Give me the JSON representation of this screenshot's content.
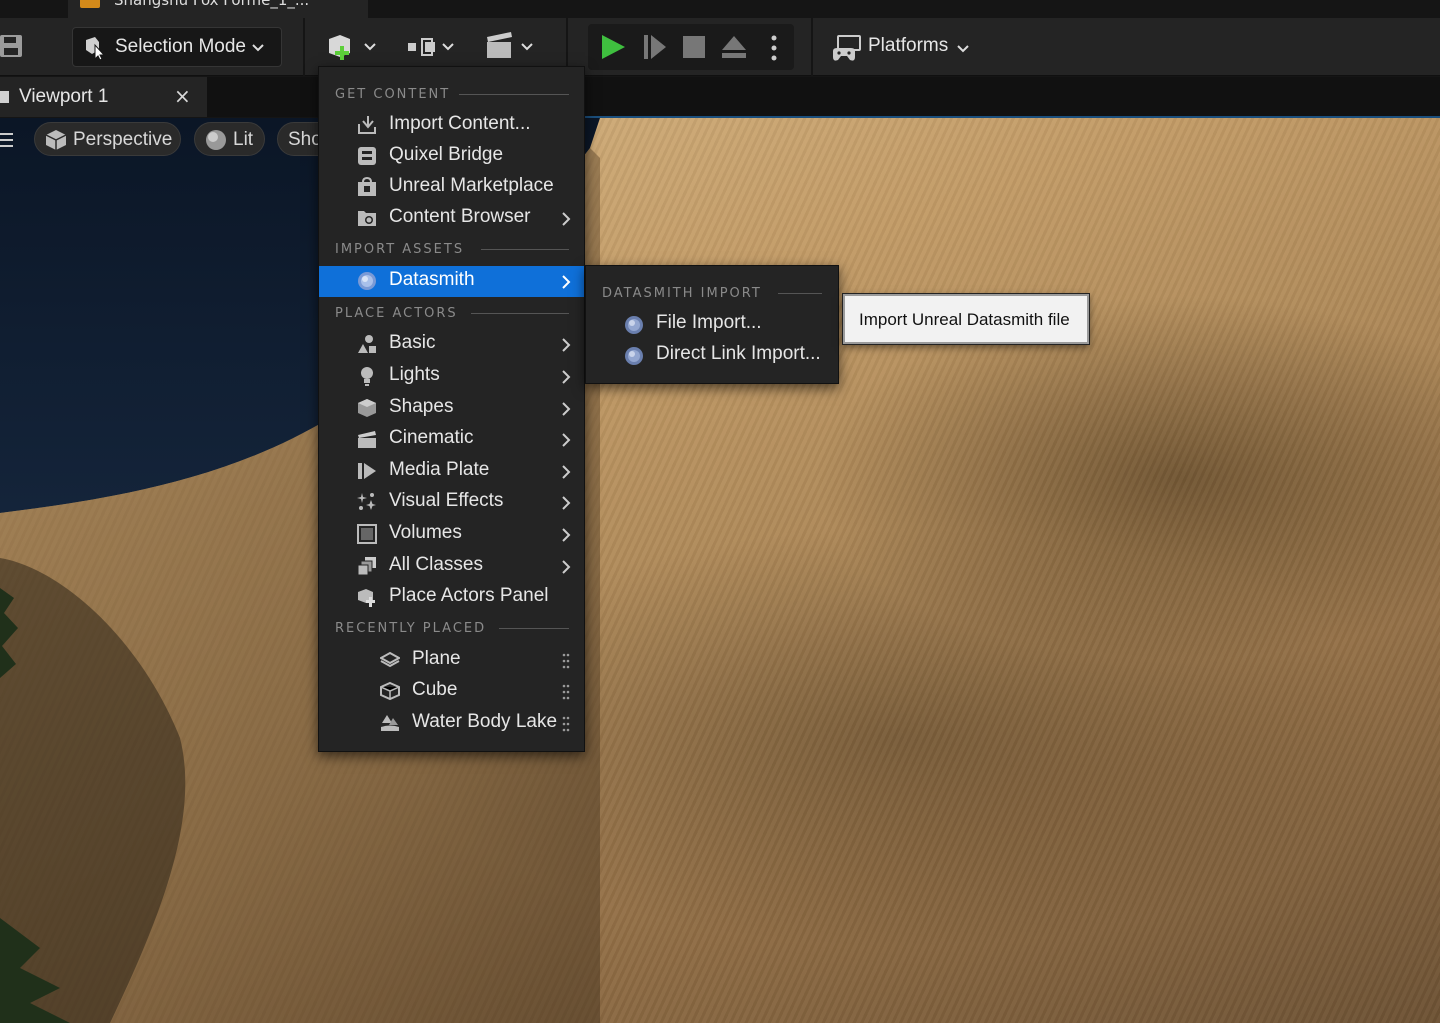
{
  "window": {
    "tab_title": "Shangshu Fox Forme_1_..."
  },
  "toolbar": {
    "selection_mode": "Selection Mode",
    "platforms": "Platforms",
    "accent_play": "#3fbf3f"
  },
  "viewport_tab": {
    "label": "Viewport 1",
    "close": "×"
  },
  "viewport_bar": {
    "perspective": "Perspective",
    "lit": "Lit",
    "show": "Sho"
  },
  "menu": {
    "sections": {
      "get_content": "GET CONTENT",
      "import_assets": "IMPORT ASSETS",
      "place_actors": "PLACE ACTORS",
      "recently_placed": "RECENTLY PLACED"
    },
    "get_content_items": [
      {
        "label": "Import Content...",
        "icon": "import-icon",
        "submenu": false
      },
      {
        "label": "Quixel Bridge",
        "icon": "quixel-bridge-icon",
        "submenu": false
      },
      {
        "label": "Unreal Marketplace",
        "icon": "marketplace-icon",
        "submenu": false
      },
      {
        "label": "Content Browser",
        "icon": "content-browser-icon",
        "submenu": true
      }
    ],
    "import_assets_items": [
      {
        "label": "Datasmith",
        "icon": "datasmith-icon",
        "submenu": true,
        "selected": true
      }
    ],
    "place_actors_items": [
      {
        "label": "Basic",
        "icon": "basic-shapes-icon",
        "submenu": true
      },
      {
        "label": "Lights",
        "icon": "lightbulb-icon",
        "submenu": true
      },
      {
        "label": "Shapes",
        "icon": "shape-icon",
        "submenu": true
      },
      {
        "label": "Cinematic",
        "icon": "clapperboard-icon",
        "submenu": true
      },
      {
        "label": "Media Plate",
        "icon": "media-plate-icon",
        "submenu": true
      },
      {
        "label": "Visual Effects",
        "icon": "sparkles-icon",
        "submenu": true
      },
      {
        "label": "Volumes",
        "icon": "volume-icon",
        "submenu": true
      },
      {
        "label": "All Classes",
        "icon": "all-classes-icon",
        "submenu": true
      },
      {
        "label": "Place Actors Panel",
        "icon": "place-actors-icon",
        "submenu": false
      }
    ],
    "recently_placed_items": [
      {
        "label": "Plane",
        "icon": "plane-mesh-icon"
      },
      {
        "label": "Cube",
        "icon": "cube-mesh-icon"
      },
      {
        "label": "Water Body Lake",
        "icon": "water-body-icon"
      }
    ],
    "selected_color": "#0f70d9"
  },
  "submenu": {
    "heading": "DATASMITH IMPORT",
    "items": [
      {
        "label": "File Import...",
        "icon": "datasmith-file-icon"
      },
      {
        "label": "Direct Link Import...",
        "icon": "datasmith-link-icon"
      }
    ]
  },
  "tooltip": {
    "text": "Import Unreal Datasmith file"
  }
}
